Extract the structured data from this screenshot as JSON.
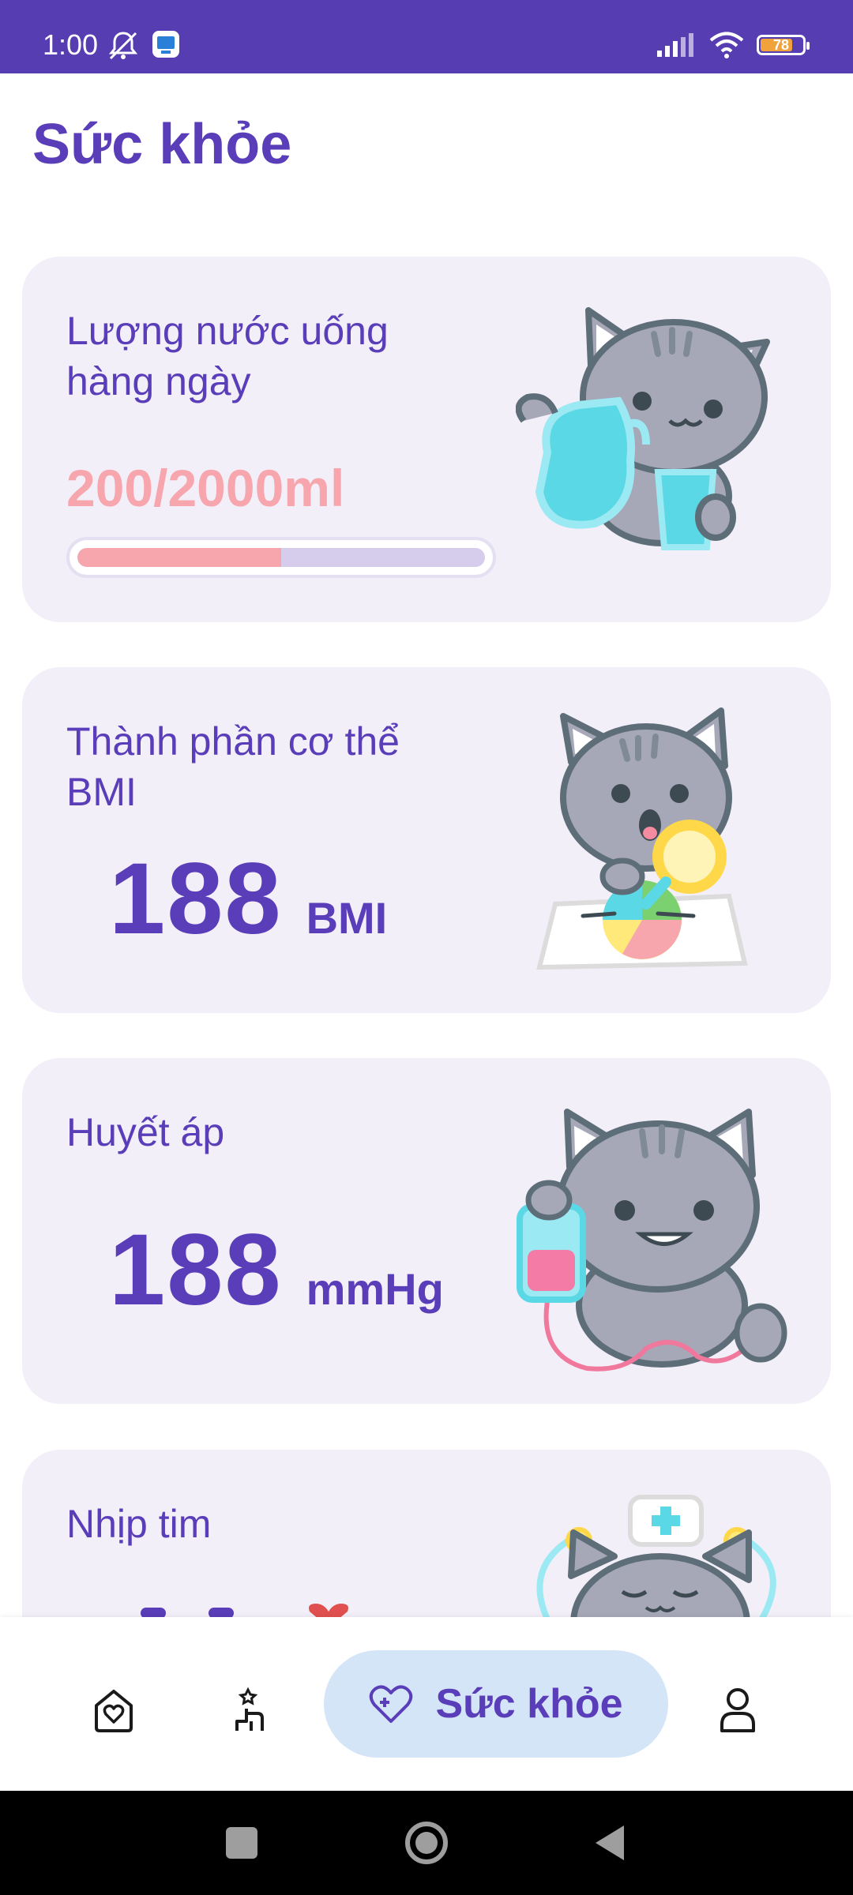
{
  "status_bar": {
    "time": "1:00",
    "battery_level": "78",
    "battery_fraction": 0.78,
    "icons": [
      "mute-bell-icon",
      "app-notification-icon",
      "signal-icon",
      "wifi-icon",
      "battery-icon"
    ]
  },
  "page": {
    "title": "Sức khỏe"
  },
  "water_card": {
    "label": "Lượng nước uống hàng ngày",
    "amount": "200/2000ml",
    "progress": 0.5,
    "illustration": "cat-with-water-jug"
  },
  "bmi_card": {
    "label": "Thành phần cơ thể BMI",
    "value": "188",
    "unit": "BMI",
    "illustration": "cat-with-magnifier-chart"
  },
  "blood_pressure_card": {
    "label": "Huyết áp",
    "value": "188",
    "unit": "mmHg",
    "illustration": "cat-with-blood-bag"
  },
  "heart_rate_card": {
    "label": "Nhịp tim",
    "illustration": "cat-nurse"
  },
  "bottom_nav": {
    "active_label": "Sức khỏe",
    "items": [
      "home-heart-icon",
      "activity-icon",
      "health-heart-icon",
      "profile-icon"
    ]
  },
  "colors": {
    "primary": "#5a3db8",
    "status_bar": "#563db1",
    "card_background": "#f3eff9",
    "water_pink": "#f7a6ae",
    "active_tab": "#d5e5f8"
  }
}
